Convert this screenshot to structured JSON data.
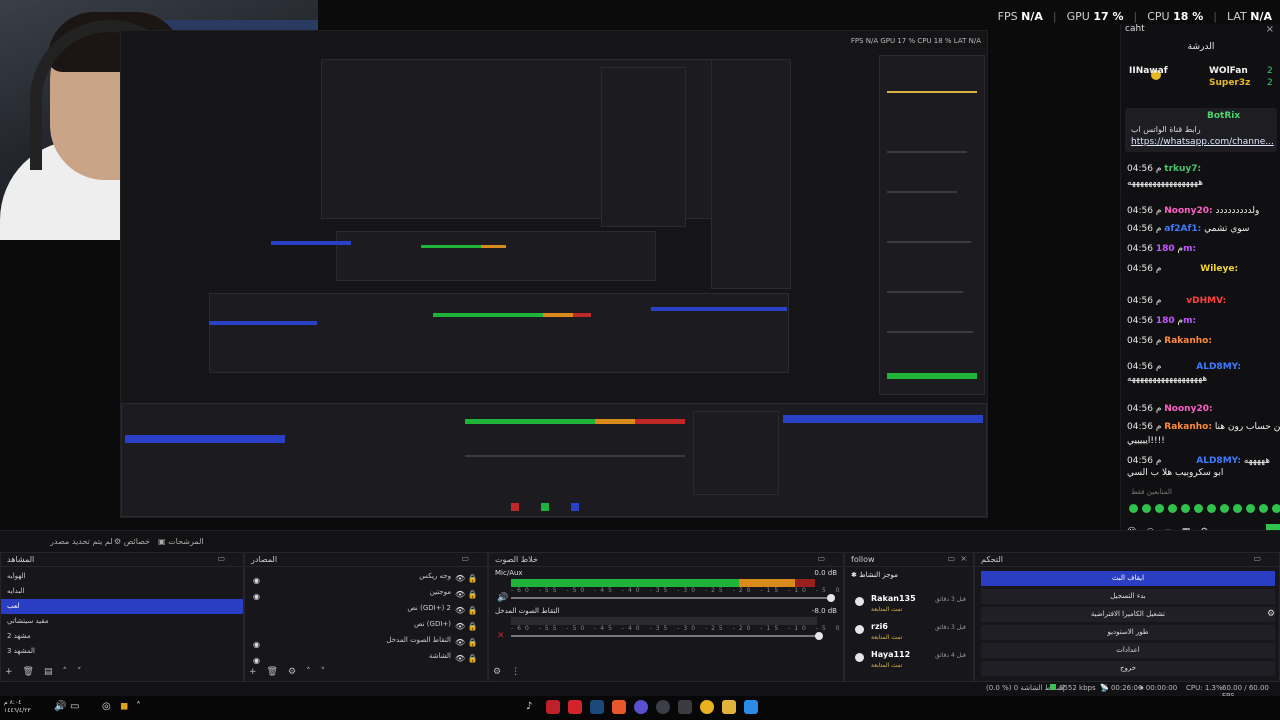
{
  "stats": {
    "fps_label": "FPS",
    "fps_value": "N/A",
    "gpu_label": "GPU",
    "gpu_value": "17 %",
    "cpu_label": "CPU",
    "cpu_value": "18 %",
    "lat_label": "LAT",
    "lat_value": "N/A"
  },
  "nested_stats": "FPS N/A   GPU 17 %   CPU 18 %   LAT N/A",
  "chat": {
    "header": "caht",
    "close": "×",
    "leaderboard_title": "الدرشة",
    "leaders": [
      {
        "name": "IINawaf",
        "score": "2"
      },
      {
        "name": "WOlFan",
        "score": "2"
      },
      {
        "name": "Super3z",
        "score": "2"
      }
    ],
    "pinned": {
      "bot": "BotRix",
      "line1": "رابط قناة الواتس اب",
      "link": "https://whatsapp.com/channe..."
    },
    "messages": [
      {
        "time": "04:56 م",
        "user": "trkuy7:",
        "color": "#49c46b",
        "text": ""
      },
      {
        "time": "",
        "user": "",
        "color": "#ffffff",
        "text": "هههههههههههههههههه"
      },
      {
        "time": "04:56 م",
        "user": "Noony20:",
        "color": "#ff5fc8",
        "text": "ولددددددددد"
      },
      {
        "time": "04:56 م",
        "user": "af2Af1:",
        "color": "#3f7bff",
        "text": "سوي تشمي"
      },
      {
        "time": "04:56 م",
        "user": "180m:",
        "color": "#c256ff",
        "text": ""
      },
      {
        "time": "04:56 م",
        "user": "Wileye:",
        "color": "#f2d43a",
        "text": ""
      },
      {
        "time": "04:56 م",
        "user": "vDHMV:",
        "color": "#ff4040",
        "text": ""
      },
      {
        "time": "04:56 م",
        "user": "180m:",
        "color": "#c256ff",
        "text": ""
      },
      {
        "time": "04:56 م",
        "user": "Rakanho:",
        "color": "#ff8a3d",
        "text": ""
      },
      {
        "time": "04:56 م",
        "user": "ALD8MY:",
        "color": "#3f7bff",
        "text": ""
      },
      {
        "time": "",
        "user": "",
        "color": "#ffffff",
        "text": "ههههههههههههههههههه"
      },
      {
        "time": "04:56 م",
        "user": "Noony20:",
        "color": "#ff5fc8",
        "text": ""
      },
      {
        "time": "04:56 م",
        "user": "Rakanho:",
        "color": "#ff8a3d",
        "text": "وين حساب رون هنا"
      },
      {
        "time": "",
        "user": "",
        "color": "#ffffff",
        "text": "ايييييي!!!!"
      },
      {
        "time": "04:56 م",
        "user": "ALD8MY:",
        "color": "#3f7bff",
        "text": "هههههه"
      },
      {
        "time": "",
        "user": "",
        "color": "#ffffff",
        "text": "ابو سكروبيب هلا ب السي"
      }
    ],
    "sub_line": "المتابعين فقط"
  },
  "midbar": {
    "a": "لم يتم تحديد مصدر",
    "b": "خصائص",
    "c": "المرشحات"
  },
  "scenes": {
    "title": "المشاهد",
    "items": [
      "الهوايه",
      "البدايه",
      "لعب",
      "مقيد سيتشاتي",
      "مشهد 2",
      "المشهد 3"
    ],
    "selected": 2
  },
  "sources": {
    "title": "المصادر",
    "items": [
      "وجه ريكس",
      "موجتين",
      "نص (GDI+) 2",
      "نص (GDI+)",
      "التقاط الصوت المدخل",
      "الشاشة"
    ]
  },
  "mixer": {
    "title": "خلاط الصوت",
    "ch1": "Mic/Aux",
    "ch1_db": "0.0 dB",
    "ch2": "التقاط الصوت المدخل",
    "ch2_db": "-8.0 dB",
    "ticks": "-60 -55 -50 -45 -40 -35 -30 -25 -20 -15 -10 -5 0"
  },
  "follow": {
    "title": "follow",
    "subtitle": "موجز النشاط",
    "events": [
      {
        "name": "Rakan135",
        "desc": "تمت المتابعة",
        "ago": "قبل 3 دقائق"
      },
      {
        "name": "rzi6",
        "desc": "تمت المتابعة",
        "ago": "قبل 3 دقائق"
      },
      {
        "name": "Haya112",
        "desc": "تمت المتابعة",
        "ago": "قبل 4 دقائق"
      }
    ]
  },
  "controls": {
    "title": "التحكم",
    "buttons": [
      "ايقاف البث",
      "بدء التسجيل",
      "تشغيل الكاميرا الافتراضية",
      "طور الاستوديو",
      "اعدادات",
      "خروج"
    ]
  },
  "statusbar": {
    "dropped": "(0.0 %) 0 إسقاط الشاشة",
    "kbps": "6552 kbps",
    "live": "00:26:06",
    "rec": "00:00:00",
    "cpu": "CPU: 1.3%",
    "fps": "60.00 / 60.00 FPS"
  },
  "taskbar": {
    "date": "١٤٤٦/٤/٢٣",
    "time": "٨:٠٤ م"
  },
  "colors": {
    "accent_blue": "#2a3ec4",
    "meter_green": "#1fb33a",
    "meter_yellow": "#d88a1c",
    "meter_red": "#c02828"
  }
}
